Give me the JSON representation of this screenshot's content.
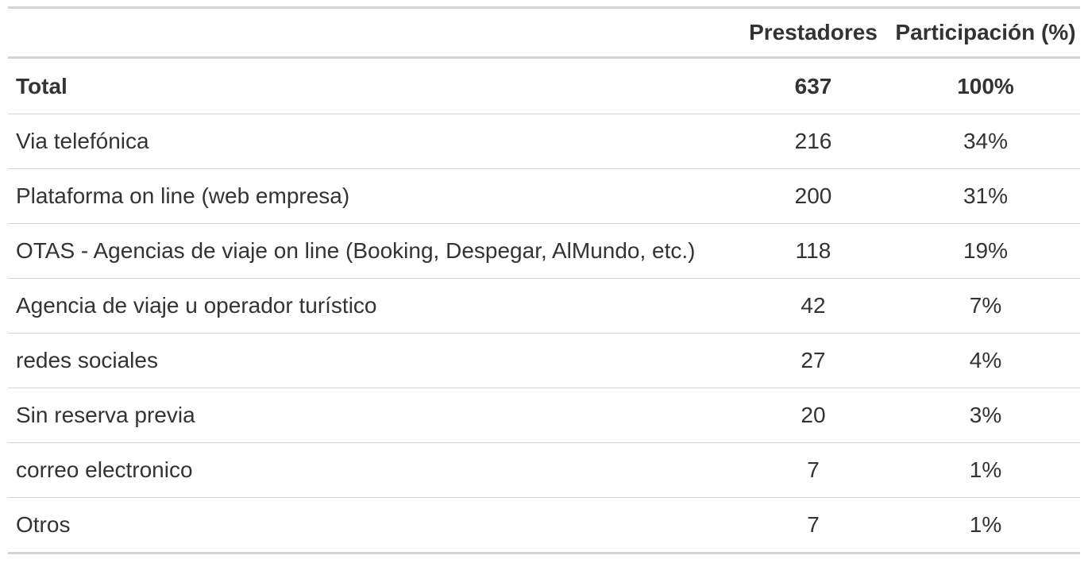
{
  "table": {
    "headers": {
      "label": "",
      "prestadores": "Prestadores",
      "participacion": "Participación (%)"
    },
    "rows": [
      {
        "label": "Total",
        "prestadores": "637",
        "participacion": "100%"
      },
      {
        "label": "Via telefónica",
        "prestadores": "216",
        "participacion": "34%"
      },
      {
        "label": "Plataforma on line (web empresa)",
        "prestadores": "200",
        "participacion": "31%"
      },
      {
        "label": "OTAS - Agencias de viaje on line (Booking, Despegar, AlMundo, etc.)",
        "prestadores": "118",
        "participacion": "19%"
      },
      {
        "label": "Agencia de viaje u operador turístico",
        "prestadores": "42",
        "participacion": "7%"
      },
      {
        "label": "redes sociales",
        "prestadores": "27",
        "participacion": "4%"
      },
      {
        "label": "Sin reserva previa",
        "prestadores": "20",
        "participacion": "3%"
      },
      {
        "label": "correo electronico",
        "prestadores": "7",
        "participacion": "1%"
      },
      {
        "label": "Otros",
        "prestadores": "7",
        "participacion": "1%"
      }
    ]
  },
  "colors": {
    "text": "#333333",
    "rule": "#d3d3d3",
    "background": "#ffffff"
  }
}
